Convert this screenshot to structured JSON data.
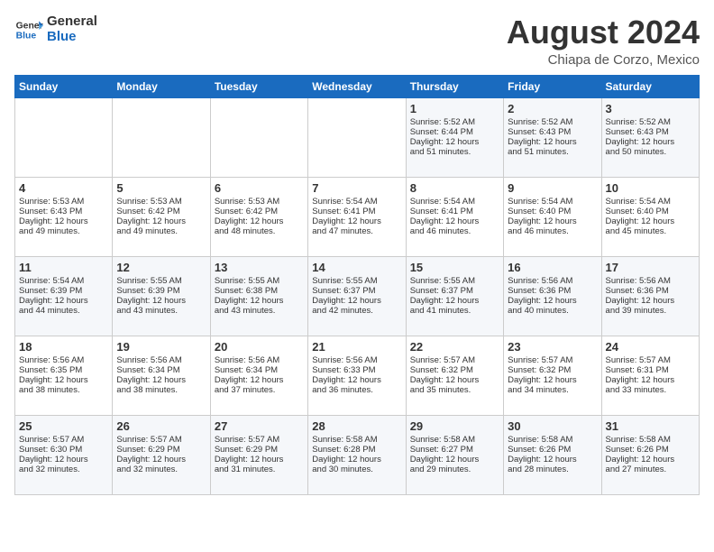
{
  "header": {
    "logo_line1": "General",
    "logo_line2": "Blue",
    "month_year": "August 2024",
    "location": "Chiapa de Corzo, Mexico"
  },
  "days_of_week": [
    "Sunday",
    "Monday",
    "Tuesday",
    "Wednesday",
    "Thursday",
    "Friday",
    "Saturday"
  ],
  "weeks": [
    [
      {
        "day": "",
        "info": ""
      },
      {
        "day": "",
        "info": ""
      },
      {
        "day": "",
        "info": ""
      },
      {
        "day": "",
        "info": ""
      },
      {
        "day": "1",
        "info": "Sunrise: 5:52 AM\nSunset: 6:44 PM\nDaylight: 12 hours\nand 51 minutes."
      },
      {
        "day": "2",
        "info": "Sunrise: 5:52 AM\nSunset: 6:43 PM\nDaylight: 12 hours\nand 51 minutes."
      },
      {
        "day": "3",
        "info": "Sunrise: 5:52 AM\nSunset: 6:43 PM\nDaylight: 12 hours\nand 50 minutes."
      }
    ],
    [
      {
        "day": "4",
        "info": "Sunrise: 5:53 AM\nSunset: 6:43 PM\nDaylight: 12 hours\nand 49 minutes."
      },
      {
        "day": "5",
        "info": "Sunrise: 5:53 AM\nSunset: 6:42 PM\nDaylight: 12 hours\nand 49 minutes."
      },
      {
        "day": "6",
        "info": "Sunrise: 5:53 AM\nSunset: 6:42 PM\nDaylight: 12 hours\nand 48 minutes."
      },
      {
        "day": "7",
        "info": "Sunrise: 5:54 AM\nSunset: 6:41 PM\nDaylight: 12 hours\nand 47 minutes."
      },
      {
        "day": "8",
        "info": "Sunrise: 5:54 AM\nSunset: 6:41 PM\nDaylight: 12 hours\nand 46 minutes."
      },
      {
        "day": "9",
        "info": "Sunrise: 5:54 AM\nSunset: 6:40 PM\nDaylight: 12 hours\nand 46 minutes."
      },
      {
        "day": "10",
        "info": "Sunrise: 5:54 AM\nSunset: 6:40 PM\nDaylight: 12 hours\nand 45 minutes."
      }
    ],
    [
      {
        "day": "11",
        "info": "Sunrise: 5:54 AM\nSunset: 6:39 PM\nDaylight: 12 hours\nand 44 minutes."
      },
      {
        "day": "12",
        "info": "Sunrise: 5:55 AM\nSunset: 6:39 PM\nDaylight: 12 hours\nand 43 minutes."
      },
      {
        "day": "13",
        "info": "Sunrise: 5:55 AM\nSunset: 6:38 PM\nDaylight: 12 hours\nand 43 minutes."
      },
      {
        "day": "14",
        "info": "Sunrise: 5:55 AM\nSunset: 6:37 PM\nDaylight: 12 hours\nand 42 minutes."
      },
      {
        "day": "15",
        "info": "Sunrise: 5:55 AM\nSunset: 6:37 PM\nDaylight: 12 hours\nand 41 minutes."
      },
      {
        "day": "16",
        "info": "Sunrise: 5:56 AM\nSunset: 6:36 PM\nDaylight: 12 hours\nand 40 minutes."
      },
      {
        "day": "17",
        "info": "Sunrise: 5:56 AM\nSunset: 6:36 PM\nDaylight: 12 hours\nand 39 minutes."
      }
    ],
    [
      {
        "day": "18",
        "info": "Sunrise: 5:56 AM\nSunset: 6:35 PM\nDaylight: 12 hours\nand 38 minutes."
      },
      {
        "day": "19",
        "info": "Sunrise: 5:56 AM\nSunset: 6:34 PM\nDaylight: 12 hours\nand 38 minutes."
      },
      {
        "day": "20",
        "info": "Sunrise: 5:56 AM\nSunset: 6:34 PM\nDaylight: 12 hours\nand 37 minutes."
      },
      {
        "day": "21",
        "info": "Sunrise: 5:56 AM\nSunset: 6:33 PM\nDaylight: 12 hours\nand 36 minutes."
      },
      {
        "day": "22",
        "info": "Sunrise: 5:57 AM\nSunset: 6:32 PM\nDaylight: 12 hours\nand 35 minutes."
      },
      {
        "day": "23",
        "info": "Sunrise: 5:57 AM\nSunset: 6:32 PM\nDaylight: 12 hours\nand 34 minutes."
      },
      {
        "day": "24",
        "info": "Sunrise: 5:57 AM\nSunset: 6:31 PM\nDaylight: 12 hours\nand 33 minutes."
      }
    ],
    [
      {
        "day": "25",
        "info": "Sunrise: 5:57 AM\nSunset: 6:30 PM\nDaylight: 12 hours\nand 32 minutes."
      },
      {
        "day": "26",
        "info": "Sunrise: 5:57 AM\nSunset: 6:29 PM\nDaylight: 12 hours\nand 32 minutes."
      },
      {
        "day": "27",
        "info": "Sunrise: 5:57 AM\nSunset: 6:29 PM\nDaylight: 12 hours\nand 31 minutes."
      },
      {
        "day": "28",
        "info": "Sunrise: 5:58 AM\nSunset: 6:28 PM\nDaylight: 12 hours\nand 30 minutes."
      },
      {
        "day": "29",
        "info": "Sunrise: 5:58 AM\nSunset: 6:27 PM\nDaylight: 12 hours\nand 29 minutes."
      },
      {
        "day": "30",
        "info": "Sunrise: 5:58 AM\nSunset: 6:26 PM\nDaylight: 12 hours\nand 28 minutes."
      },
      {
        "day": "31",
        "info": "Sunrise: 5:58 AM\nSunset: 6:26 PM\nDaylight: 12 hours\nand 27 minutes."
      }
    ]
  ]
}
